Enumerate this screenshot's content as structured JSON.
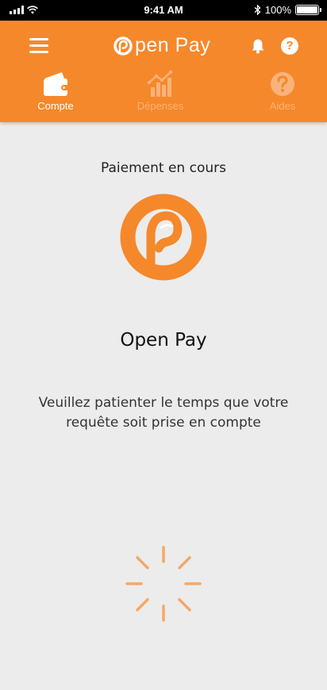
{
  "status_bar": {
    "time": "9:41 AM",
    "battery": "100%",
    "icons": [
      "signal-icon",
      "wifi-icon",
      "bluetooth-icon",
      "battery-icon"
    ]
  },
  "header": {
    "brand": "pen Pay",
    "icons": [
      "menu-icon",
      "open-pay-logo",
      "bell-icon",
      "help-icon"
    ],
    "tabs": [
      {
        "label": "Compte",
        "icon": "wallet-icon",
        "active": true
      },
      {
        "label": "Dépenses",
        "icon": "bar-chart-icon",
        "active": false
      },
      {
        "label": "Aides",
        "icon": "help-circle-icon",
        "active": false
      }
    ]
  },
  "main": {
    "title": "Paiement en cours",
    "app_name": "Open Pay",
    "message": "Veuillez patienter le temps que votre requête soit prise en compte",
    "spinner_icon": "loading-spinner-icon"
  },
  "colors": {
    "accent": "#f5882a",
    "background": "#ececec",
    "tab_inactive": "#f9b27a"
  }
}
